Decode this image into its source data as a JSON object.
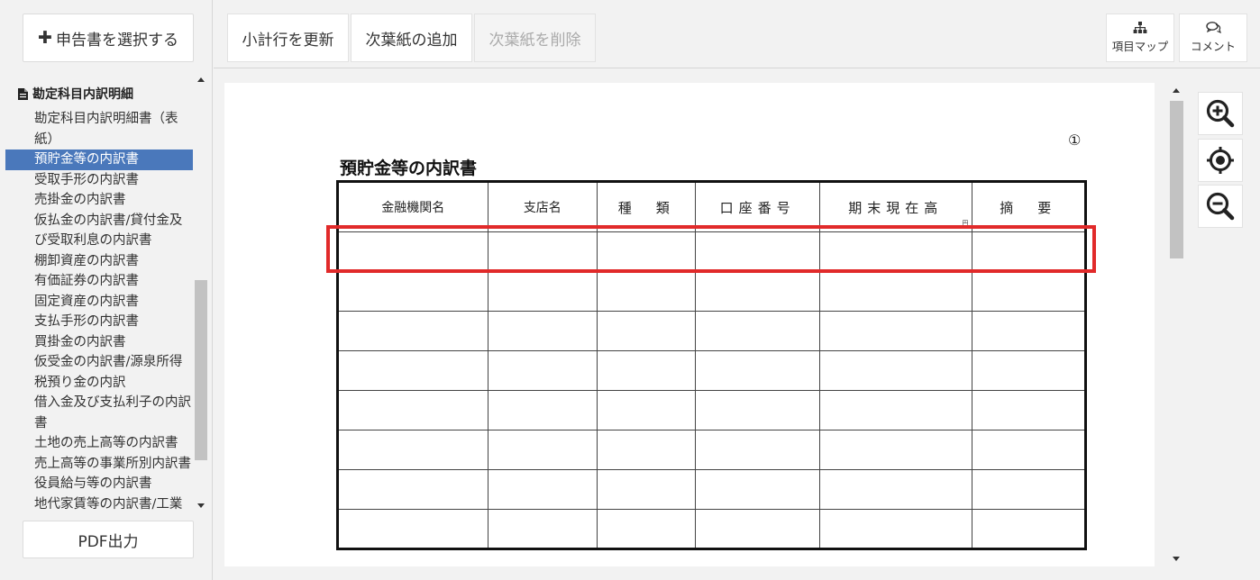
{
  "sidebar": {
    "select_label": "申告書を選択する",
    "tree_header": "勘定科目内訳明細",
    "items": [
      {
        "label": "勘定科目内訳明細書（表紙）",
        "active": false
      },
      {
        "label": "預貯金等の内訳書",
        "active": true
      },
      {
        "label": "受取手形の内訳書",
        "active": false
      },
      {
        "label": "売掛金の内訳書",
        "active": false
      },
      {
        "label": "仮払金の内訳書/貸付金及び受取利息の内訳書",
        "active": false
      },
      {
        "label": "棚卸資産の内訳書",
        "active": false
      },
      {
        "label": "有価証券の内訳書",
        "active": false
      },
      {
        "label": "固定資産の内訳書",
        "active": false
      },
      {
        "label": "支払手形の内訳書",
        "active": false
      },
      {
        "label": "買掛金の内訳書",
        "active": false
      },
      {
        "label": "仮受金の内訳書/源泉所得税預り金の内訳",
        "active": false
      },
      {
        "label": "借入金及び支払利子の内訳書",
        "active": false
      },
      {
        "label": "土地の売上高等の内訳書",
        "active": false
      },
      {
        "label": "売上高等の事業所別内訳書",
        "active": false
      },
      {
        "label": "役員給与等の内訳書",
        "active": false
      },
      {
        "label": "地代家賃等の内訳書/工業",
        "active": false
      }
    ],
    "pdf_label": "PDF出力"
  },
  "toolbar": {
    "update_label": "小計行を更新",
    "add_label": "次葉紙の追加",
    "delete_label": "次葉紙を削除",
    "map_label": "項目マップ",
    "comment_label": "コメント"
  },
  "document": {
    "page_number": "①",
    "title": "預貯金等の内訳書",
    "columns": [
      "金融機関名",
      "支店名",
      "種　類",
      "口座番号",
      "期末現在高",
      "摘　要"
    ],
    "unit": "円",
    "row_count": 8
  },
  "colors": {
    "active_item": "#4a78bb",
    "highlight": "#e12a2a"
  },
  "icons": {
    "select": "plus-icon",
    "tree_header": "document-icon",
    "map": "sitemap-icon",
    "comment": "comment-icon",
    "zoom_in": "zoom-in-icon",
    "center": "crosshair-icon",
    "zoom_out": "zoom-out-icon"
  }
}
